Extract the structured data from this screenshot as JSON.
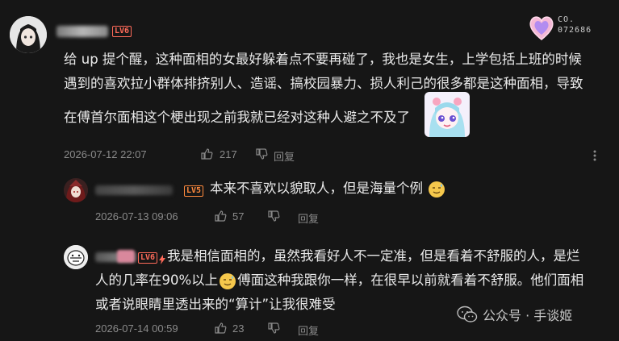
{
  "comments": [
    {
      "level": "LV6",
      "text_lines": [
        "给 up 提个醒，这种面相的女最好躲着点不要再碰了，我也是女生，上学包括上班的时候",
        "遇到的喜欢拉小群体排挤别人、造谣、搞校园暴力、损人利己的很多都是这种面相，导致",
        "在傅首尔面相这个梗出现之前我就已经对这种人避之不及了"
      ],
      "date": "2026-07-12 22:07",
      "likes": "217",
      "reply_label": "回复",
      "badge_lines": [
        "CO.",
        "072686"
      ]
    },
    {
      "level": "LV5",
      "text": "本来不喜欢以貌取人，但是海量个例",
      "date": "2026-07-13 09:06",
      "likes": "57",
      "reply_label": "回复"
    },
    {
      "level": "LV6",
      "text_lines": [
        "我是相信面相的，虽然我看好人不一定准，但是看着不舒服的人，是烂",
        "人的几率在90%以上",
        "傅面这种我跟你一样，在很早以前就看着不舒服。他们面相",
        "或者说眼睛里透出来的“算计”让我很难受"
      ],
      "date": "2026-07-14 00:59",
      "likes": "23",
      "reply_label": "回复"
    }
  ],
  "watermark": "公众号 · 手谈姬"
}
